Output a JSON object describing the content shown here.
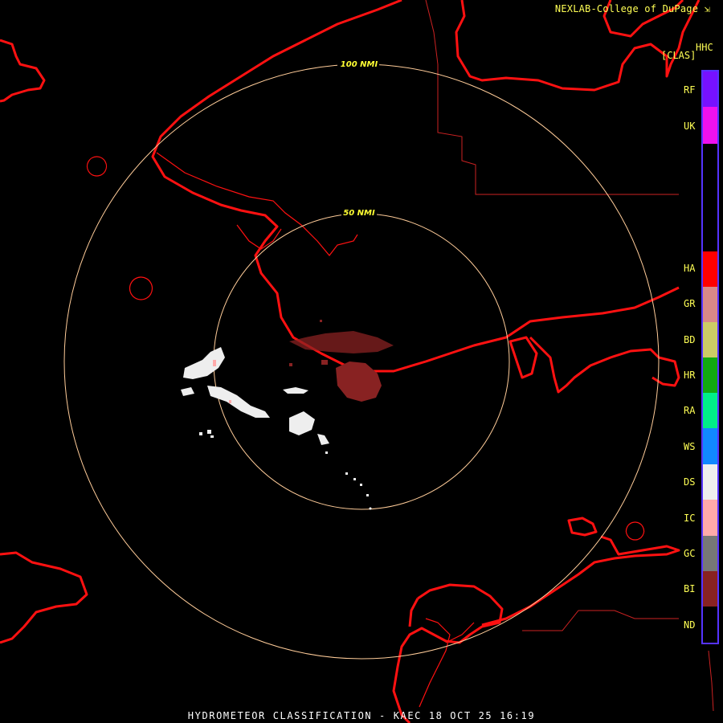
{
  "header": {
    "credit": "NEXLAB-College of DuPage",
    "credit_icon": "corner-arrow-icon",
    "product_code": "HHC",
    "units": "[CLAS]"
  },
  "range_rings": [
    {
      "label": "50 NMI"
    },
    {
      "label": "100 NMI"
    }
  ],
  "legend": {
    "categories": [
      {
        "code": "RF",
        "color": "#7711ff"
      },
      {
        "code": "UK",
        "color": "#ee11ee"
      },
      {
        "code": "HA",
        "color": "#ff0000"
      },
      {
        "code": "GR",
        "color": "#d98888"
      },
      {
        "code": "BD",
        "color": "#cccc66"
      },
      {
        "code": "HR",
        "color": "#11aa11"
      },
      {
        "code": "RA",
        "color": "#00ee88"
      },
      {
        "code": "WS",
        "color": "#1188ff"
      },
      {
        "code": "DS",
        "color": "#eeeeee"
      },
      {
        "code": "IC",
        "color": "#ffaaaa"
      },
      {
        "code": "GC",
        "color": "#777777"
      },
      {
        "code": "BI",
        "color": "#882222"
      },
      {
        "code": "ND",
        "color": "#000000"
      }
    ]
  },
  "colors": {
    "coastline": "#ff1111",
    "boundary": "#cc2222",
    "ring": "#ffcc99"
  },
  "footer": {
    "title": "HYDROMETEOR CLASSIFICATION - KAEC 18 OCT 25 16:19"
  }
}
